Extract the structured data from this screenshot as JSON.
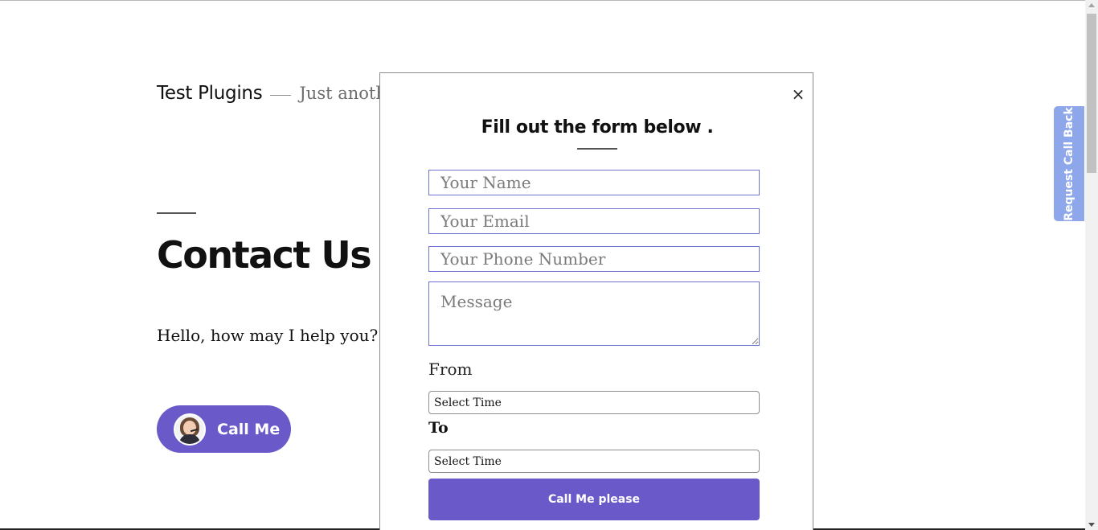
{
  "page": {
    "site_title": "Test Plugins",
    "site_description": "Just anothe",
    "title": "Contact Us",
    "body_text": "Hello, how may I help you? Jus",
    "call_me_label": "Call Me"
  },
  "modal": {
    "close_symbol": "×",
    "title": "Fill out the form below .",
    "fields": {
      "name_placeholder": "Your Name",
      "email_placeholder": "Your Email",
      "phone_placeholder": "Your Phone Number",
      "message_placeholder": "Message"
    },
    "from_label": "From",
    "to_label": "To",
    "from_select": "Select Time",
    "to_select": "Select Time",
    "submit_label": "Call Me please"
  },
  "side_tab": {
    "label": "Request Call Back"
  },
  "colors": {
    "accent": "#6a59c9",
    "side_tab": "#8ea6ea",
    "field_border": "#6d73d2"
  }
}
